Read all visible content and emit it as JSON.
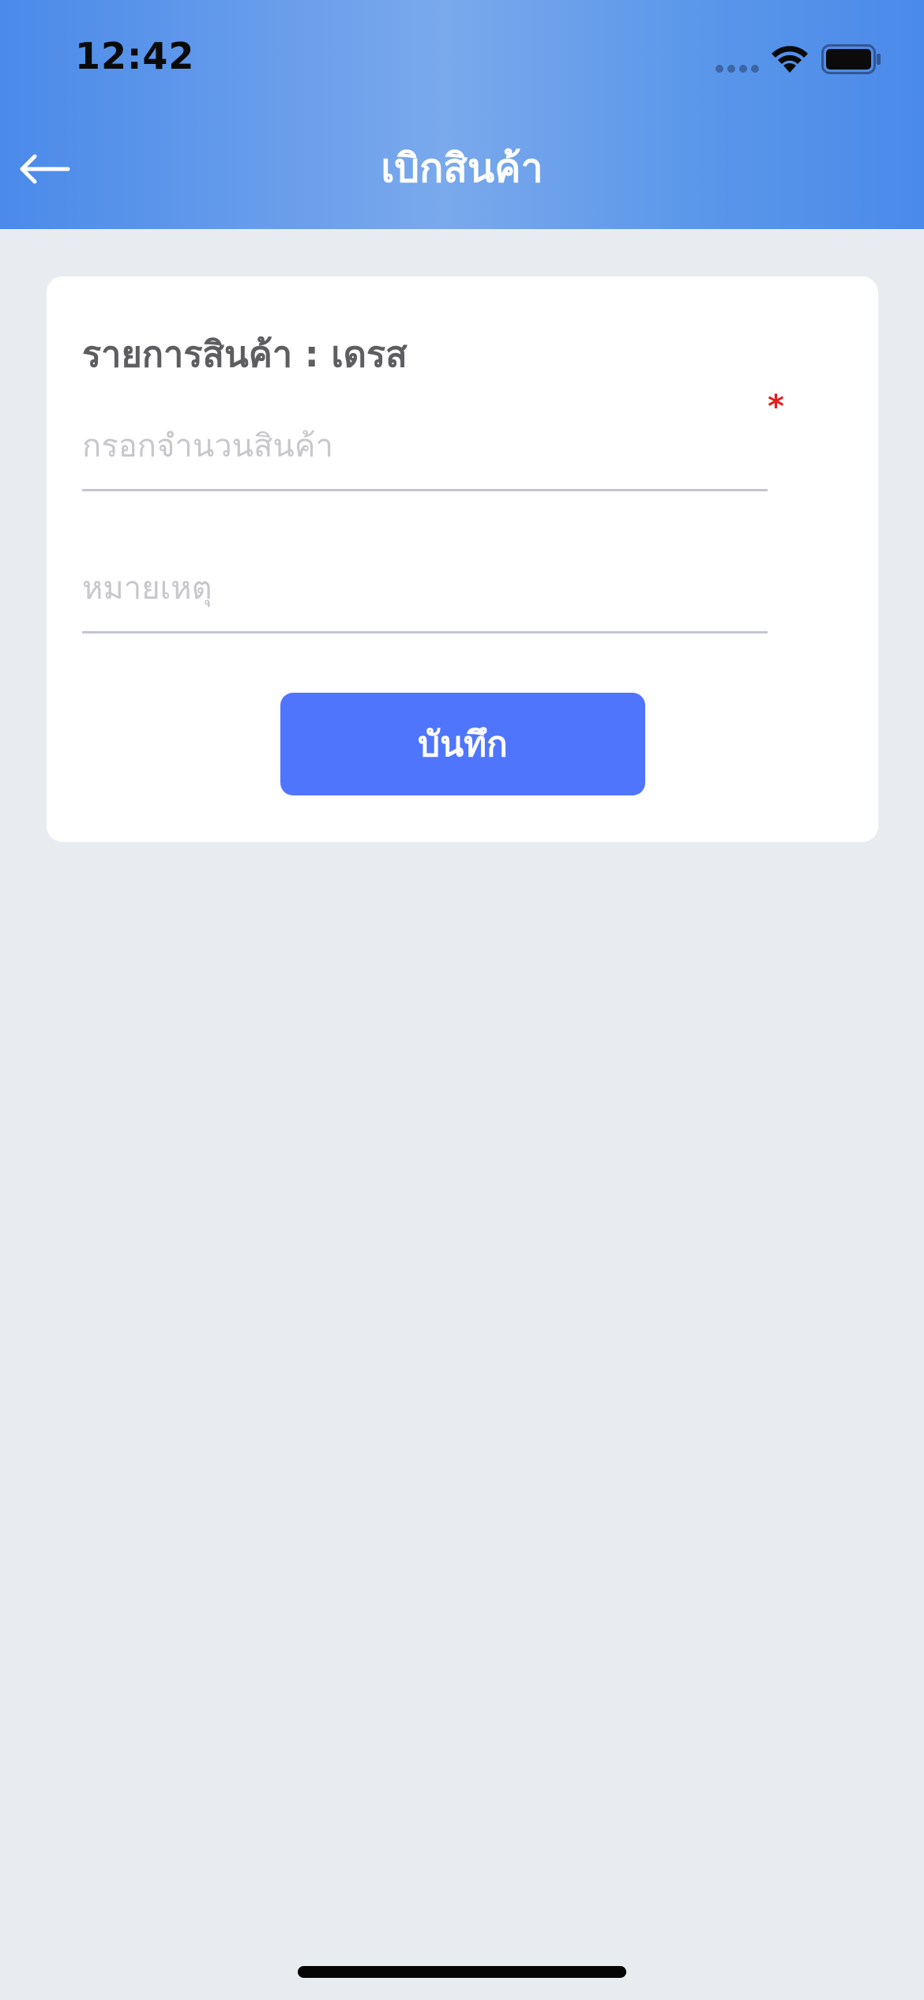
{
  "status_bar": {
    "time": "12:42"
  },
  "header": {
    "title": "เบิกสินค้า",
    "back_icon": "arrow-left-icon",
    "gradient_colors": [
      "#4a8aea",
      "#7aa9ec",
      "#4a8aea"
    ]
  },
  "card": {
    "heading": "รายการสินค้า : เดรส",
    "required_mark": "*",
    "quantity_placeholder": "กรอกจำนวนสินค้า",
    "quantity_value": "",
    "note_placeholder": "หมายเหตุ",
    "note_value": "",
    "save_label": "บันทึก",
    "button_color": "#5075fd",
    "required_color": "#e21f1f"
  }
}
